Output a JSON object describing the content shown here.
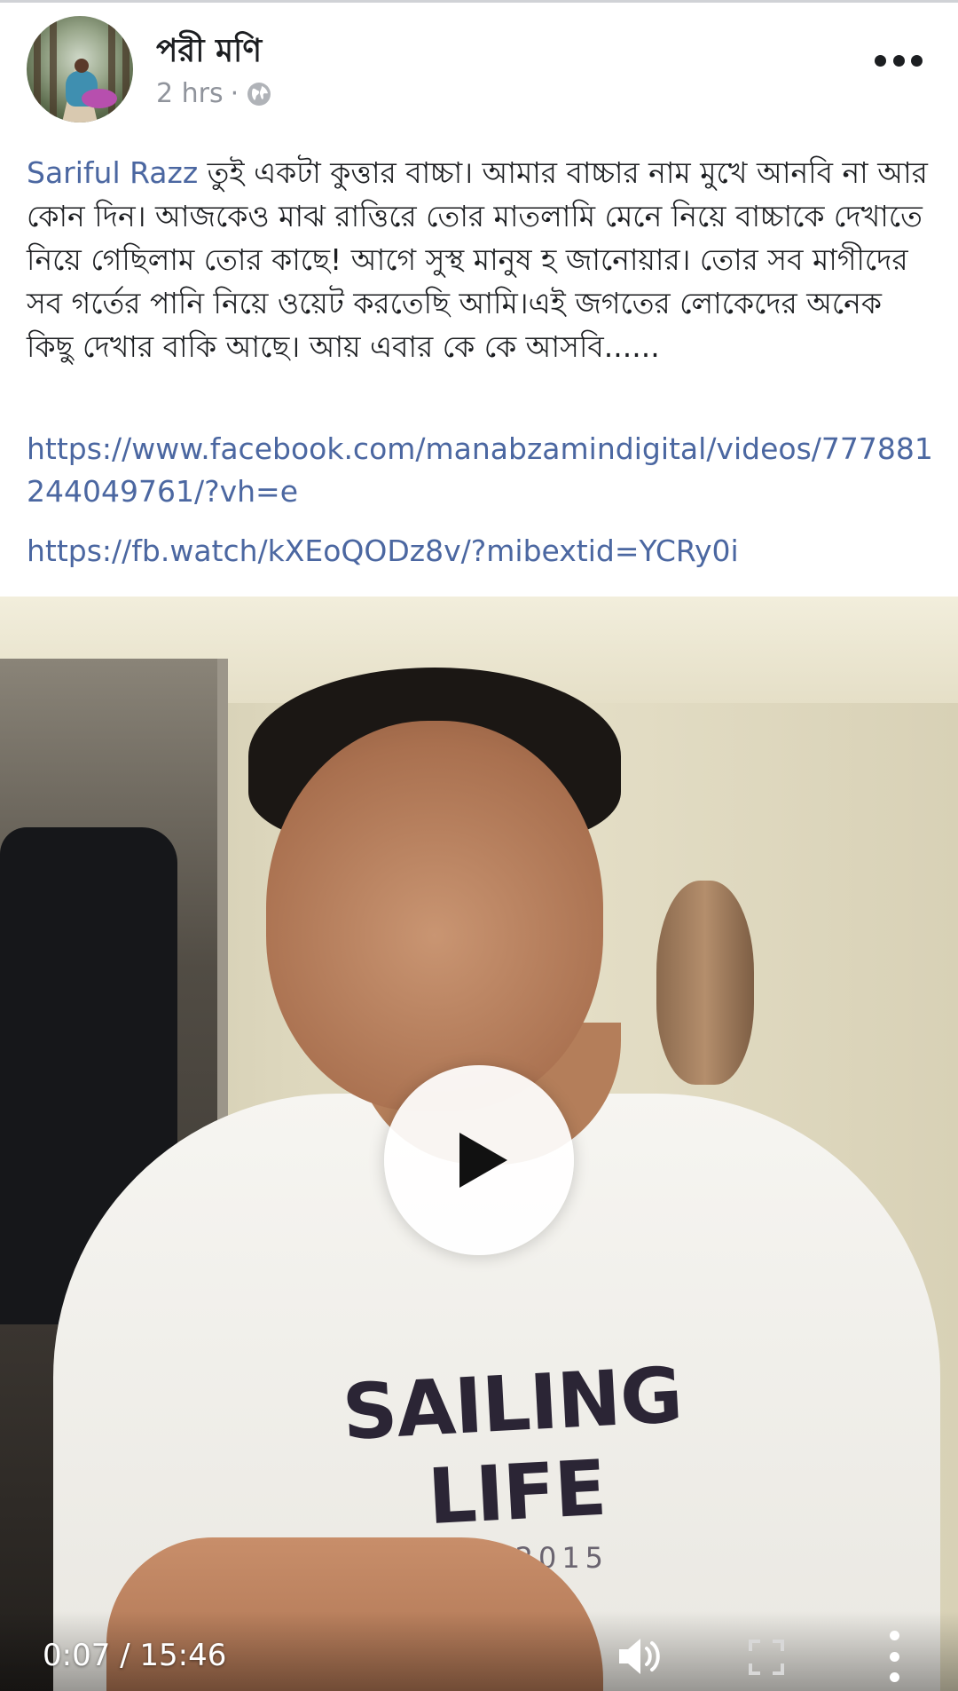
{
  "post": {
    "author": "পরী মণি",
    "time": "2 hrs",
    "separator": "·",
    "privacy_icon": "globe-icon",
    "menu_icon": "more-horizontal-icon",
    "mention": "Sariful Razz",
    "text": " তুই একটা কুত্তার বাচ্চা। আমার বাচ্চার নাম মুখে আনবি না আর কোন দিন। আজকেও মাঝ রাত্তিরে তোর মাতলামি মেনে নিয়ে বাচ্চাকে দেখাতে নিয়ে গেছিলাম তোর কাছে! আগে সুস্থ মানুষ হ জানোয়ার। তোর সব মাগীদের সব গর্তের পানি নিয়ে ওয়েট করতেছি আমি।এই জগতের লোকেদের অনেক কিছু দেখার বাকি আছে। আয় এবার কে কে আসবি......",
    "links": [
      "https://www.facebook.com/manabzamindigital/videos/777881244049761/?vh=e",
      "https://fb.watch/kXEoQODz8v/?mibextid=YCRy0i"
    ]
  },
  "video": {
    "time_display": "0:07 / 15:46",
    "shirt_text": "SAILING LIFE",
    "shirt_subtext": "EST. 2015",
    "play_icon": "play-icon",
    "volume_icon": "volume-icon",
    "fullscreen_icon": "fullscreen-icon",
    "more_icon": "more-vertical-icon",
    "progress_fraction": 0.0074
  },
  "colors": {
    "link": "#4b67a1",
    "text": "#1c1e21",
    "meta": "#90949c"
  }
}
